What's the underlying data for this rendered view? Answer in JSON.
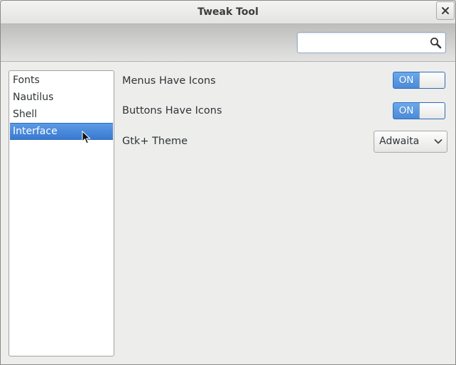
{
  "window": {
    "title": "Tweak Tool"
  },
  "search": {
    "value": "",
    "placeholder": ""
  },
  "sidebar": {
    "selected_index": 3,
    "items": [
      {
        "label": "Fonts"
      },
      {
        "label": "Nautilus"
      },
      {
        "label": "Shell"
      },
      {
        "label": "Interface"
      }
    ]
  },
  "settings": {
    "menus_icons": {
      "label": "Menus Have Icons",
      "state": "ON"
    },
    "buttons_icons": {
      "label": "Buttons Have Icons",
      "state": "ON"
    },
    "gtk_theme": {
      "label": "Gtk+ Theme",
      "value": "Adwaita"
    }
  },
  "colors": {
    "accent": "#4a8ad9",
    "selection": "#3a7ad0",
    "window_bg": "#ededec"
  }
}
